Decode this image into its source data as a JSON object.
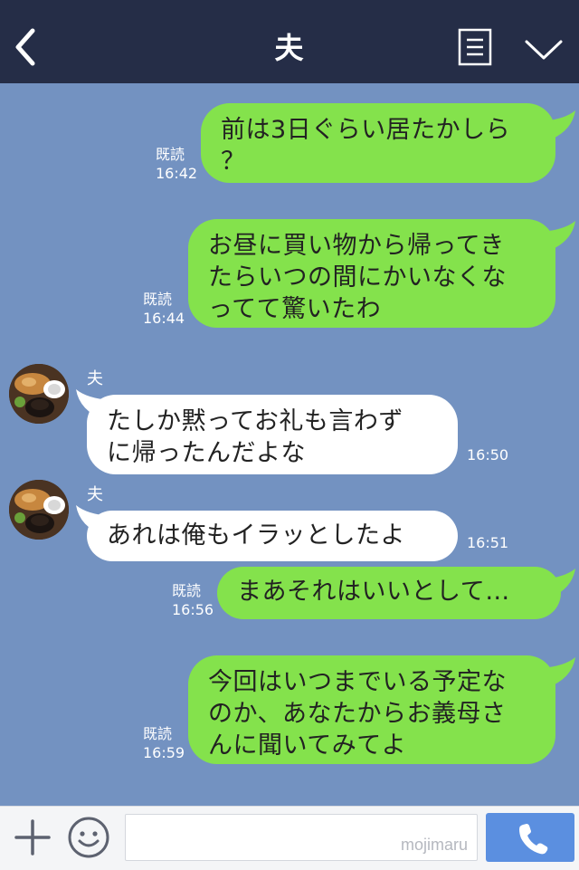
{
  "header": {
    "title": "夫",
    "back_icon": "chevron-left-icon",
    "notes_icon": "notes-icon",
    "menu_icon": "chevron-down-icon"
  },
  "messages": [
    {
      "side": "sent",
      "text_lines": [
        "前は3日ぐらい居たかしら",
        "？"
      ],
      "read": "既読",
      "time": "16:42"
    },
    {
      "side": "sent",
      "text_lines": [
        "お昼に買い物から帰ってき",
        "たらいつの間にかいなくな",
        "ってて驚いたわ"
      ],
      "read": "既読",
      "time": "16:44"
    },
    {
      "side": "received",
      "sender": "夫",
      "text_lines": [
        "たしか黙ってお礼も言わず",
        "に帰ったんだよな"
      ],
      "time": "16:50"
    },
    {
      "side": "received",
      "sender": "夫",
      "text_lines": [
        "あれは俺もイラッとしたよ"
      ],
      "time": "16:51"
    },
    {
      "side": "sent",
      "text_lines": [
        "まあそれはいいとして…"
      ],
      "read": "既読",
      "time": "16:56"
    },
    {
      "side": "sent",
      "text_lines": [
        "今回はいつまでいる予定な",
        "のか、あなたからお義母さ",
        "んに聞いてみてよ"
      ],
      "read": "既読",
      "time": "16:59"
    }
  ],
  "input_bar": {
    "plus_icon": "plus-icon",
    "emoji_icon": "emoji-icon",
    "call_icon": "phone-icon",
    "watermark": "mojimaru"
  },
  "colors": {
    "header_bg": "#252d47",
    "chat_bg": "#7392c1",
    "sent_bubble": "#84e24c",
    "received_bubble": "#ffffff",
    "call_button": "#5b8fe0"
  }
}
